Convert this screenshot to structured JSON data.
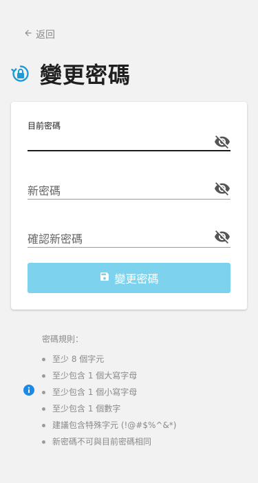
{
  "nav": {
    "back_label": "返回"
  },
  "page": {
    "title": "變更密碼"
  },
  "form": {
    "current_password": {
      "label": "目前密碼",
      "value": ""
    },
    "new_password": {
      "placeholder": "新密碼"
    },
    "confirm_password": {
      "placeholder": "確認新密碼"
    },
    "submit_label": "變更密碼"
  },
  "rules": {
    "heading": "密碼規則：",
    "items": [
      "至少 8 個字元",
      "至少包含 1 個大寫字母",
      "至少包含 1 個小寫字母",
      "至少包含 1 個數字",
      "建議包含特殊字元 (!@#$%^&*)",
      "新密碼不可與目前密碼相同"
    ]
  },
  "colors": {
    "accent": "#1e9bd7",
    "button_disabled": "#7dd3ee",
    "background": "#f2f2f2",
    "card": "#ffffff"
  },
  "icons": {
    "back": "arrow-left-icon",
    "title": "lock-reset-icon",
    "password_toggle": "eye-off-icon",
    "submit": "save-icon",
    "rules": "info-icon"
  }
}
